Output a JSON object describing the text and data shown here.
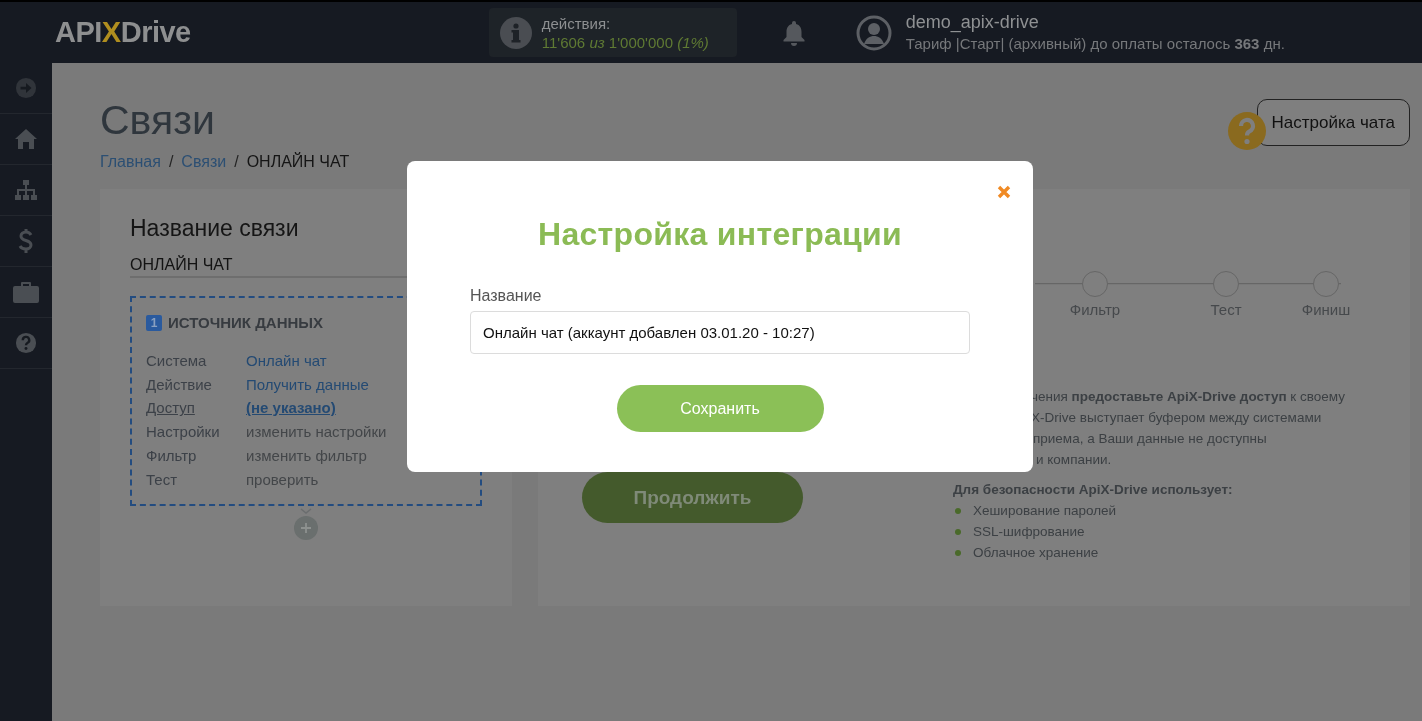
{
  "header": {
    "logo": [
      "API",
      "X",
      "Drive"
    ],
    "actions": {
      "label": "действия:",
      "value": "11'606 *из* 1'000'000 *(1%)*"
    },
    "user": {
      "name": "demo_apix-drive",
      "tariff": "Тариф |Старт| (архивный) до оплаты осталось **363** дн."
    }
  },
  "page": {
    "title": "Связи",
    "breadcrumb_separator": "/",
    "breadcrumbs": [
      {
        "label": "Главная",
        "link": true
      },
      {
        "label": "Связи",
        "link": true
      },
      {
        "label": "ОНЛАЙН ЧАТ",
        "link": false
      }
    ],
    "help_button": "Настройка чата"
  },
  "connection_card": {
    "heading": "Название связи",
    "name_value": "ОНЛАЙН ЧАТ",
    "source": {
      "number": "1",
      "title": "ИСТОЧНИК ДАННЫХ",
      "rows": [
        {
          "label": "Система",
          "value": "Онлайн чат",
          "kind": "link"
        },
        {
          "label": "Действие",
          "value": "Получить данные",
          "kind": "link"
        },
        {
          "label": "Доступ",
          "value": "(не указано)",
          "kind": "missing"
        },
        {
          "label": "Настройки",
          "value": "изменить настройки",
          "kind": "plain"
        },
        {
          "label": "Фильтр",
          "value": "изменить фильтр",
          "kind": "plain"
        },
        {
          "label": "Тест",
          "value": "проверить",
          "kind": "plain"
        }
      ]
    }
  },
  "setup_panel": {
    "steps": [
      "Фильтр",
      "Тест",
      "Финиш"
    ],
    "continue_button": "Продолжить",
    "info_lines": [
      "чения **предоставьте ApiX-Drive доступ** к своему",
      "X-Drive выступает буфером между системами",
      "приема, а Ваши данные не доступны",
      "и компании."
    ],
    "security": {
      "title": "Для безопасности ApiX-Drive использует:",
      "items": [
        "Хеширование паролей",
        "SSL-шифрование",
        "Облачное хранение"
      ]
    }
  },
  "modal": {
    "title": "Настройка интеграции",
    "field_label": "Название",
    "field_value": "Онлайн чат (аккаунт добавлен 03.01.20 - 10:27)",
    "save_button": "Сохранить"
  }
}
